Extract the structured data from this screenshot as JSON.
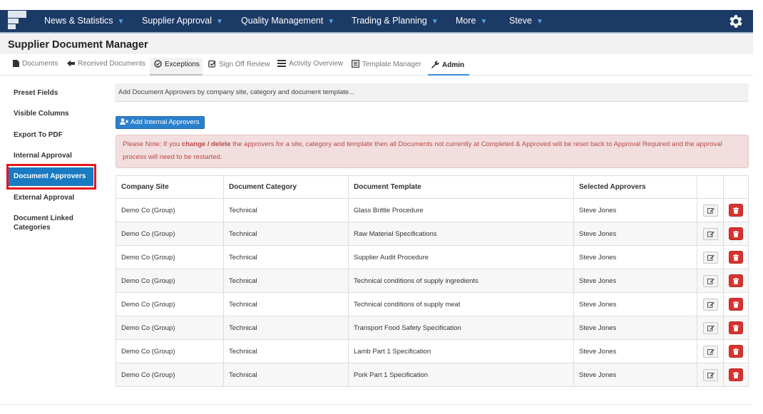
{
  "nav": {
    "items": [
      {
        "label": "News & Statistics"
      },
      {
        "label": "Supplier Approval"
      },
      {
        "label": "Quality Management"
      },
      {
        "label": "Trading & Planning"
      },
      {
        "label": "More"
      },
      {
        "label": "Steve"
      }
    ],
    "caret": "▼"
  },
  "page": {
    "title": "Supplier Document Manager"
  },
  "tabs": [
    {
      "label": "Documents",
      "icon": "file-icon"
    },
    {
      "label": "Received Documents",
      "icon": "arrow-left-icon"
    },
    {
      "label": "Exceptions",
      "icon": "check-circle-icon"
    },
    {
      "label": "Sign Off Review",
      "icon": "check-square-icon"
    },
    {
      "label": "Activity Overview",
      "icon": "list-icon"
    },
    {
      "label": "Template Manager",
      "icon": "template-icon"
    },
    {
      "label": "Admin",
      "icon": "wrench-icon"
    }
  ],
  "sidebar": {
    "items": [
      {
        "label": "Preset Fields"
      },
      {
        "label": "Visible Columns"
      },
      {
        "label": "Export To PDF"
      },
      {
        "label": "Internal Approval"
      },
      {
        "label": "Document Approvers"
      },
      {
        "label": "External Approval"
      },
      {
        "label": "Document Linked Categories"
      }
    ]
  },
  "main": {
    "info": "Add Document Approvers by company site, category and document template...",
    "add_button": "Add Internal Approvers",
    "alert": {
      "prefix": "Please Note: If you ",
      "emphasis": "change / delete",
      "suffix": " the approvers for a site, category and template then all Documents not currently at Completed & Approved will be reset back to Approval Required and the approval process will need to be restarted."
    },
    "table": {
      "headers": [
        "Company Site",
        "Document Category",
        "Document Template",
        "Selected Approvers"
      ],
      "rows": [
        [
          "Demo Co (Group)",
          "Technical",
          "Glass Brittle Procedure",
          "Steve Jones"
        ],
        [
          "Demo Co (Group)",
          "Technical",
          "Raw Material Specifications",
          "Steve Jones"
        ],
        [
          "Demo Co (Group)",
          "Technical",
          "Supplier Audit Procedure",
          "Steve Jones"
        ],
        [
          "Demo Co (Group)",
          "Technical",
          "Technical conditions of supply ingredients",
          "Steve Jones"
        ],
        [
          "Demo Co (Group)",
          "Technical",
          "Technical conditions of supply meat",
          "Steve Jones"
        ],
        [
          "Demo Co (Group)",
          "Technical",
          "Transport Food Safety Specification",
          "Steve Jones"
        ],
        [
          "Demo Co (Group)",
          "Technical",
          "Lamb Part 1 Specification",
          "Steve Jones"
        ],
        [
          "Demo Co (Group)",
          "Technical",
          "Pork Part 1 Specification",
          "Steve Jones"
        ]
      ]
    }
  },
  "colors": {
    "nav_bg": "#1c3a66",
    "accent": "#1a7ac2",
    "danger": "#d9332f",
    "alert_bg": "#f2dede",
    "alert_text": "#b94a48"
  }
}
